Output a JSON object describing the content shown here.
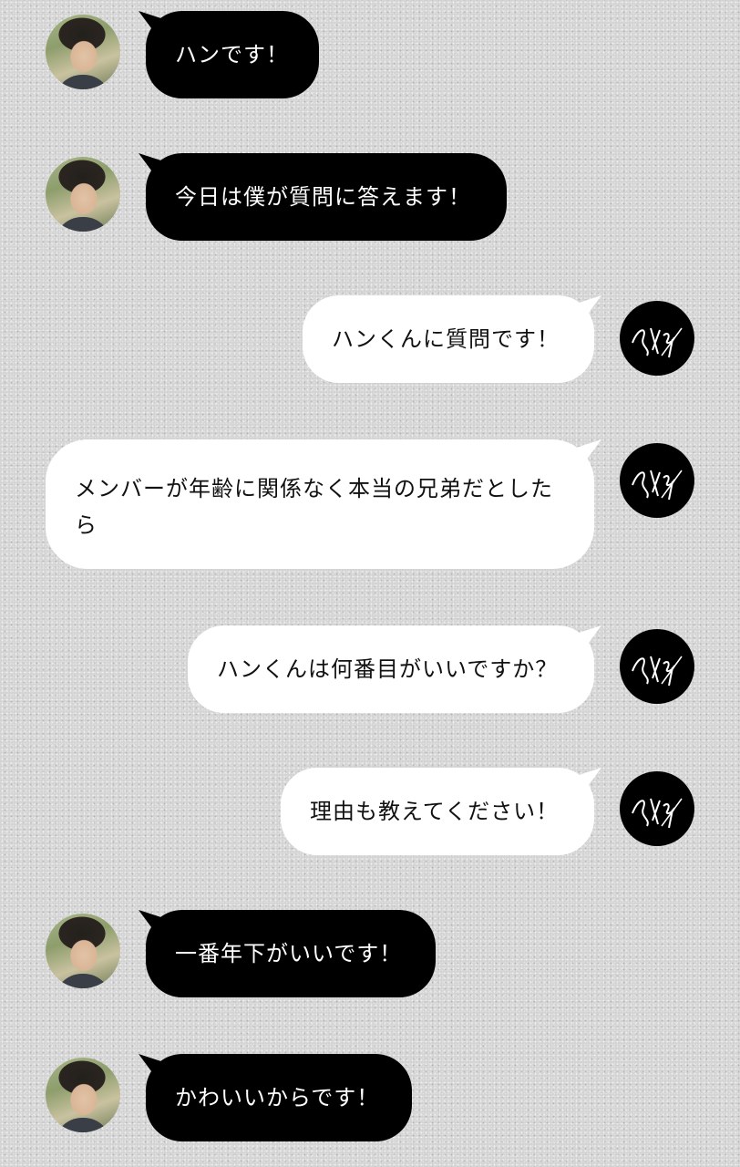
{
  "colors": {
    "left_bubble": "#000000",
    "left_text": "#ffffff",
    "right_bubble": "#ffffff",
    "right_text": "#111111"
  },
  "messages": [
    {
      "side": "left",
      "avatar": "member-photo-avatar",
      "text": "ハンです！"
    },
    {
      "side": "left",
      "avatar": "member-photo-avatar",
      "text": "今日は僕が質問に答えます！"
    },
    {
      "side": "right",
      "avatar": "skz-logo-avatar",
      "text": "ハンくんに質問です！"
    },
    {
      "side": "right",
      "avatar": "skz-logo-avatar",
      "text": "メンバーが年齢に関係なく本当の兄弟だとしたら"
    },
    {
      "side": "right",
      "avatar": "skz-logo-avatar",
      "text": "ハンくんは何番目がいいですか？"
    },
    {
      "side": "right",
      "avatar": "skz-logo-avatar",
      "text": "理由も教えてください！"
    },
    {
      "side": "left",
      "avatar": "member-photo-avatar",
      "text": "一番年下がいいです！"
    },
    {
      "side": "left",
      "avatar": "member-photo-avatar",
      "text": "かわいいからです！"
    }
  ]
}
